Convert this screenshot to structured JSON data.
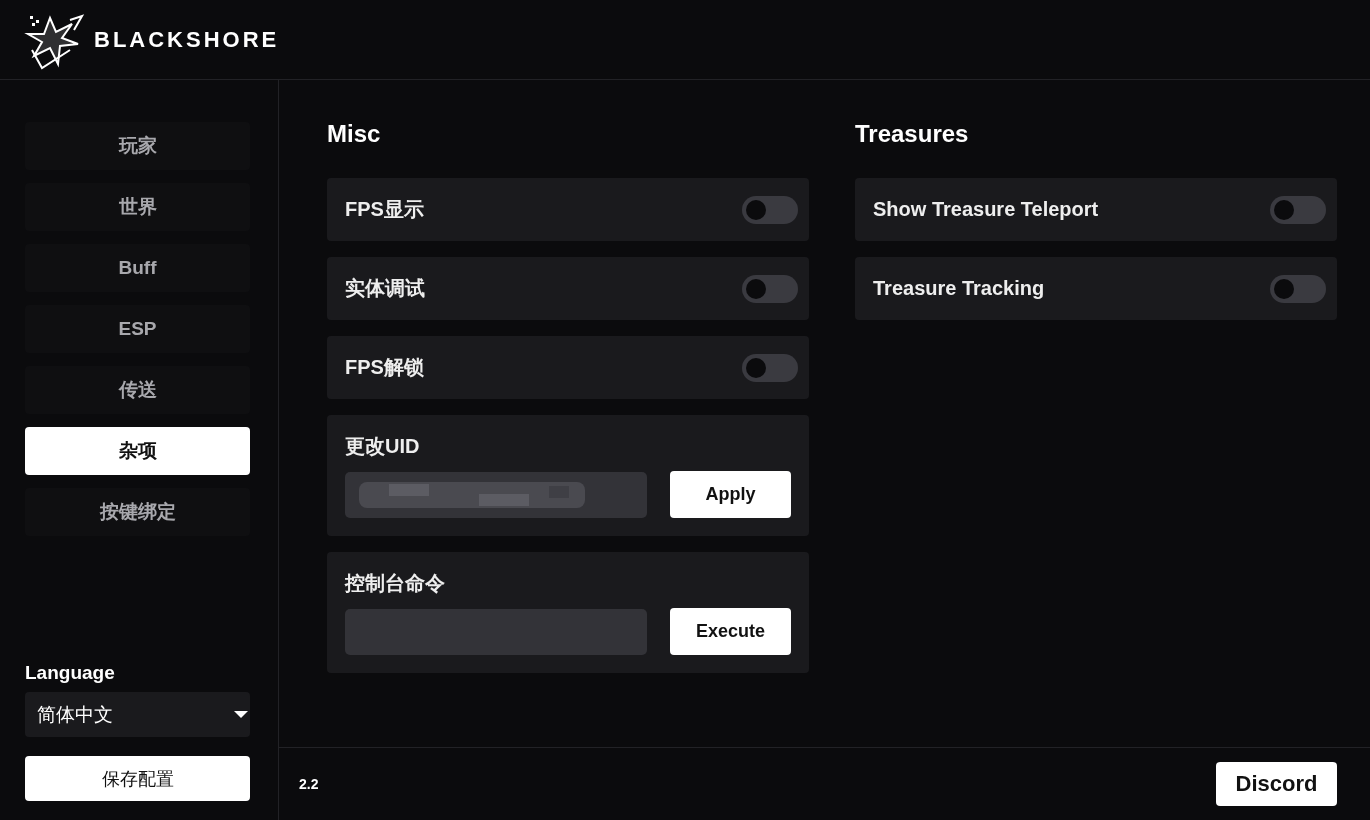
{
  "brand": {
    "name": "BLACKSHORE"
  },
  "sidebar": {
    "items": [
      {
        "label": "玩家",
        "selected": false
      },
      {
        "label": "世界",
        "selected": false
      },
      {
        "label": "Buff",
        "selected": false
      },
      {
        "label": "ESP",
        "selected": false
      },
      {
        "label": "传送",
        "selected": false
      },
      {
        "label": "杂项",
        "selected": true
      },
      {
        "label": "按键绑定",
        "selected": false
      }
    ],
    "language_label": "Language",
    "language": "简体中文",
    "save_button": "保存配置"
  },
  "sections": [
    {
      "title": "Misc",
      "items": [
        {
          "kind": "toggle",
          "label": "FPS显示",
          "on": false
        },
        {
          "kind": "toggle",
          "label": "实体调试",
          "on": false
        },
        {
          "kind": "toggle",
          "label": "FPS解锁",
          "on": false
        },
        {
          "kind": "input",
          "label": "更改UID",
          "redacted": true,
          "button": "Apply"
        },
        {
          "kind": "input",
          "label": "控制台命令",
          "redacted": false,
          "button": "Execute"
        }
      ]
    },
    {
      "title": "Treasures",
      "items": [
        {
          "kind": "toggle",
          "label": "Show Treasure Teleport",
          "on": false
        },
        {
          "kind": "toggle",
          "label": "Treasure Tracking",
          "on": false
        }
      ]
    }
  ],
  "footer": {
    "version": "2.2",
    "button": "Discord"
  }
}
